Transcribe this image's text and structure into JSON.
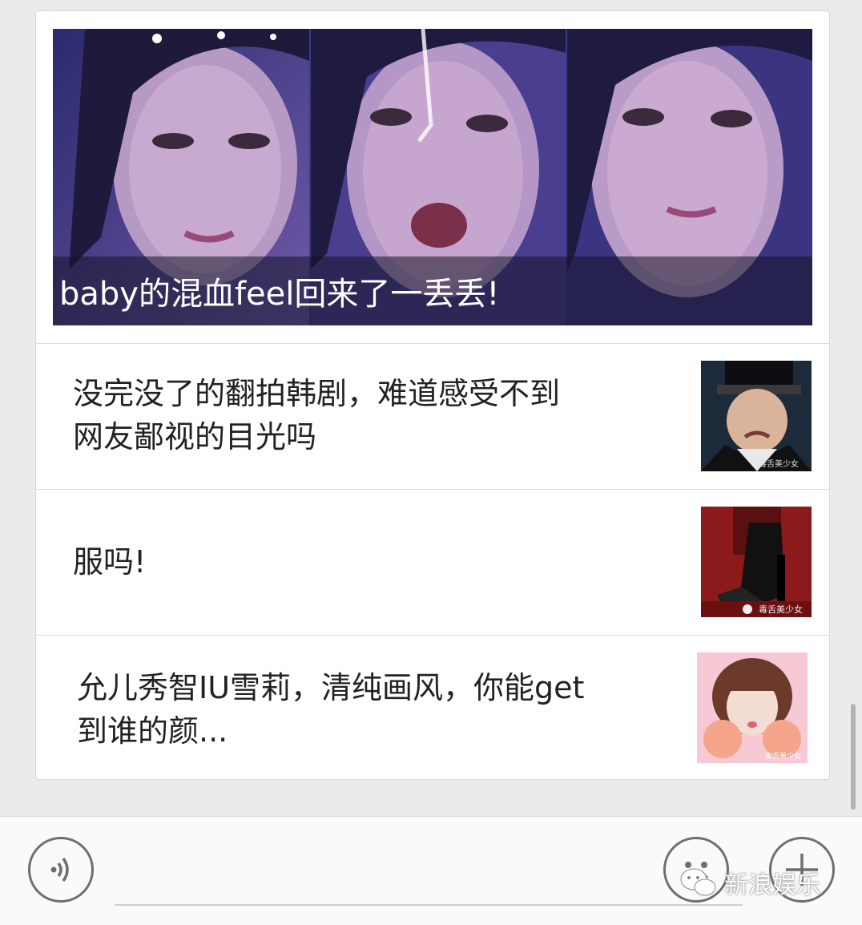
{
  "featured": {
    "caption": "baby的混血feel回来了一丢丢!"
  },
  "articles": [
    {
      "title_line1": "没完没了的翻拍韩剧，难道感受不到",
      "title_line2": "网友鄙视的目光吗",
      "thumb_watermark": "毒舌美少女"
    },
    {
      "title_line1": "服吗!",
      "title_line2": "",
      "thumb_watermark": "毒舌美少女"
    },
    {
      "title_line1": "允儿秀智IU雪莉，清纯画风，你能get",
      "title_line2": "到谁的颜...",
      "thumb_watermark": "毒舌美少女"
    }
  ],
  "bottom_bar": {
    "voice_icon": "voice-icon",
    "emoji_icon": "emoji-icon",
    "plus_icon": "plus-icon"
  },
  "watermark": {
    "text": "新浪娱乐",
    "icon": "wechat-icon"
  }
}
